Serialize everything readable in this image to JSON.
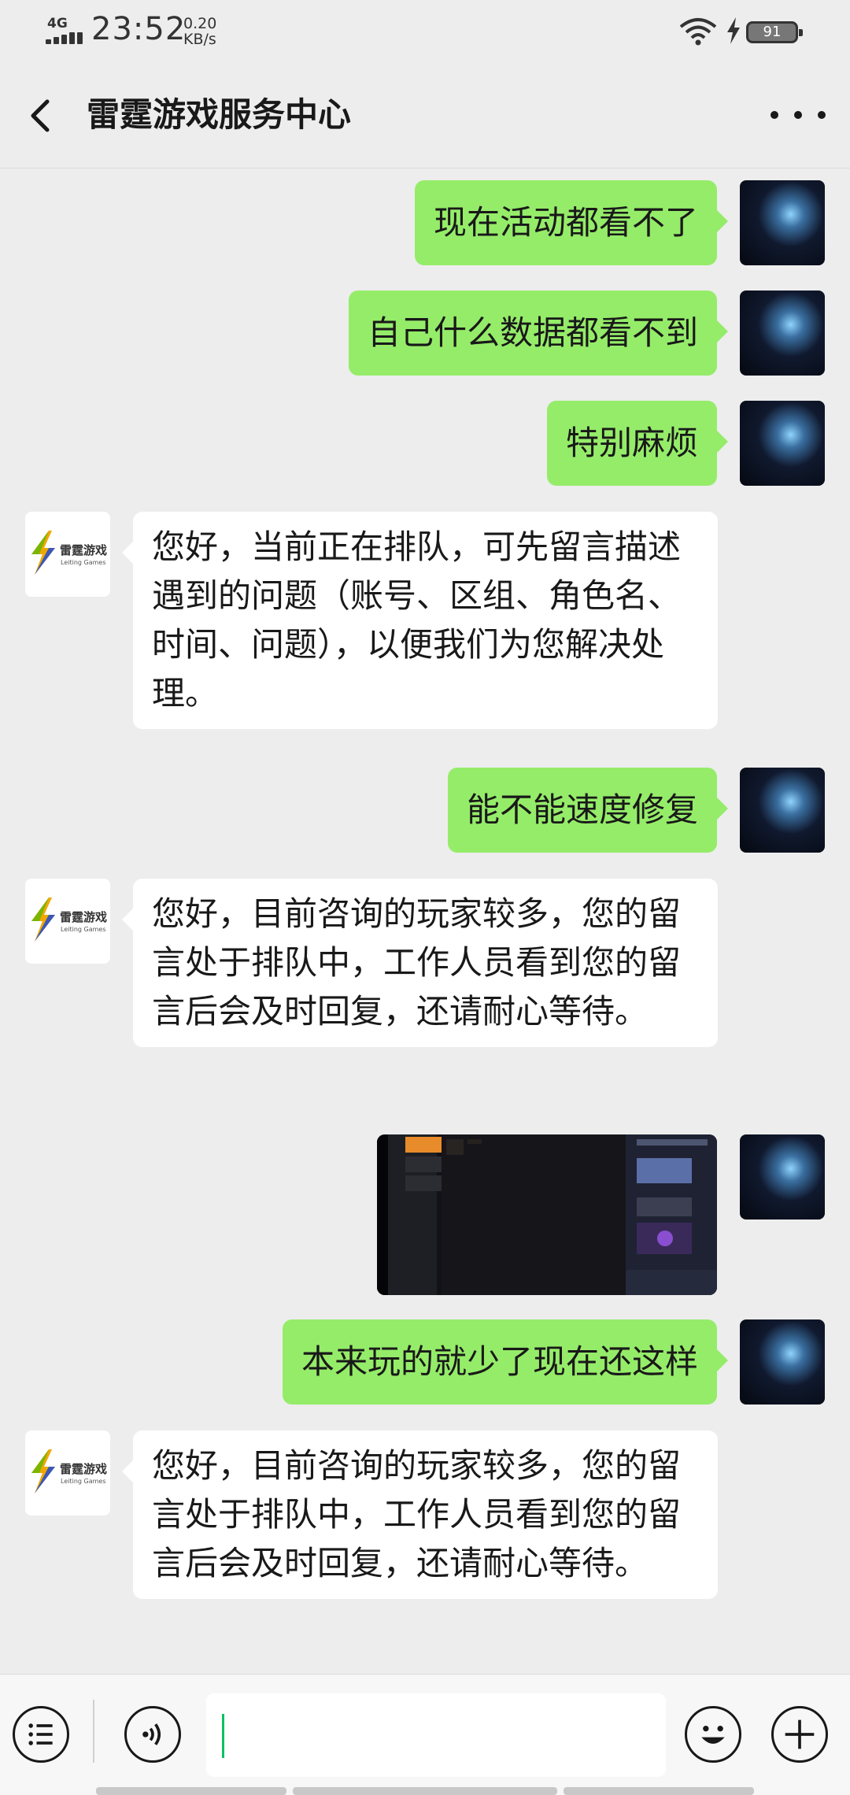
{
  "status_bar": {
    "network": "4G",
    "time": "23:52",
    "speed_value": "0.20",
    "speed_unit": "KB/s",
    "battery": "91"
  },
  "header": {
    "title": "雷霆游戏服务中心",
    "back_icon": "chevron-left-icon",
    "more_icon": "more-dots-icon"
  },
  "bot": {
    "logo_text": "雷霆游戏",
    "logo_sub": "Leiting Games"
  },
  "messages": [
    {
      "from": "user",
      "text": "现在活动都看不了"
    },
    {
      "from": "user",
      "text": "自己什么数据都看不到"
    },
    {
      "from": "user",
      "text": "特别麻烦"
    },
    {
      "from": "bot",
      "text": "您好，当前正在排队，可先留言描述遇到的问题（账号、区组、角色名、时间、问题），以便我们为您解决处理。"
    },
    {
      "from": "user",
      "text": "能不能速度修复"
    },
    {
      "from": "bot",
      "text": "您好，目前咨询的玩家较多，您的留言处于排队中，工作人员看到您的留言后会及时回复，还请耐心等待。"
    },
    {
      "from": "user",
      "type": "image",
      "text": ""
    },
    {
      "from": "user",
      "text": "本来玩的就少了现在还这样"
    },
    {
      "from": "bot",
      "text": "您好，目前咨询的玩家较多，您的留言处于排队中，工作人员看到您的留言后会及时回复，还请耐心等待。"
    }
  ],
  "input_bar": {
    "menu_icon": "list-menu-icon",
    "voice_icon": "voice-icon",
    "emoji_icon": "emoji-icon",
    "add_icon": "plus-icon",
    "input_value": ""
  },
  "colors": {
    "background": "#ededed",
    "outgoing_bubble": "#95ec69",
    "incoming_bubble": "#ffffff",
    "caret": "#07c160"
  }
}
